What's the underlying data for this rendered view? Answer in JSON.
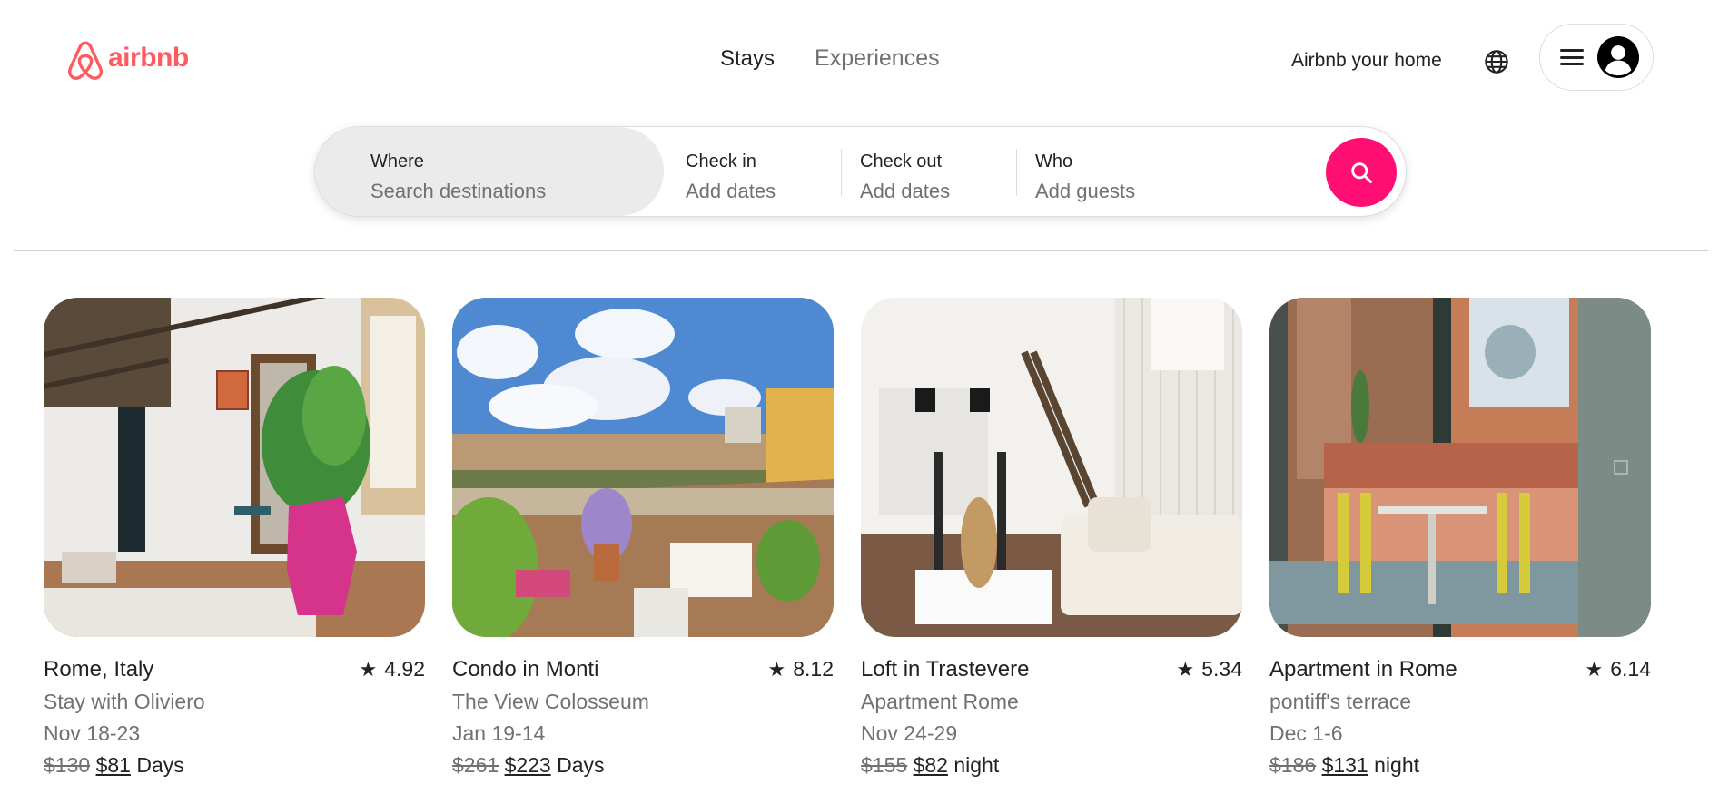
{
  "brand": {
    "name": "airbnb",
    "color": "#ff5a5f",
    "icon": "airbnb-logo-icon"
  },
  "nav": {
    "tabs": [
      {
        "label": "Stays",
        "active": true
      },
      {
        "label": "Experiences",
        "active": false
      }
    ],
    "host_link": "Airbnb your home",
    "globe_icon": "globe-icon",
    "menu_icon": "hamburger-icon",
    "avatar_icon": "user-avatar-icon"
  },
  "search": {
    "where": {
      "label": "Where",
      "value": "Search destinations"
    },
    "checkin": {
      "label": "Check in",
      "value": "Add dates"
    },
    "checkout": {
      "label": "Check out",
      "value": "Add dates"
    },
    "who": {
      "label": "Who",
      "value": "Add guests"
    },
    "button_icon": "search-icon",
    "button_color": "#ff0f73"
  },
  "listings": [
    {
      "title": "Rome, Italy",
      "rating": "4.92",
      "subtitle": "Stay with Oliviero",
      "dates": "Nov 18-23",
      "old_price": "$130",
      "new_price": "$81",
      "unit": "Days"
    },
    {
      "title": "Condo in Monti",
      "rating": "8.12",
      "subtitle": "The View Colosseum",
      "dates": "Jan 19-14",
      "old_price": "$261",
      "new_price": "$223",
      "unit": "Days"
    },
    {
      "title": "Loft in Trastevere",
      "rating": "5.34",
      "subtitle": "Apartment Rome",
      "dates": "Nov 24-29",
      "old_price": "$155",
      "new_price": "$82",
      "unit": "night"
    },
    {
      "title": "Apartment in Rome",
      "rating": "6.14",
      "subtitle": "pontiff's terrace",
      "dates": "Dec 1-6",
      "old_price": "$186",
      "new_price": "$131",
      "unit": "night"
    }
  ],
  "colors": {
    "text": "#222222",
    "muted": "#717171",
    "border": "#dddddd"
  }
}
